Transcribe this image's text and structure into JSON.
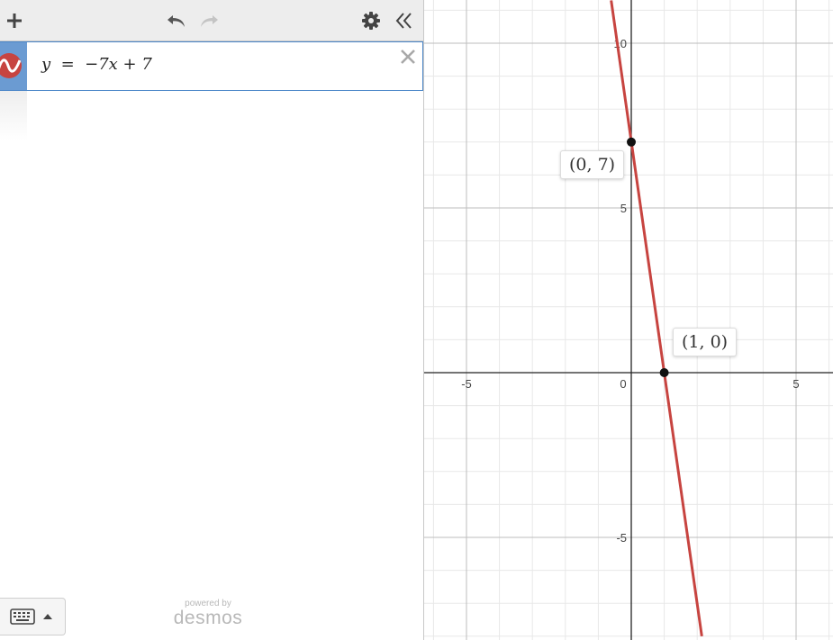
{
  "toolbar": {
    "add_icon": "plus-icon",
    "undo_icon": "undo-icon",
    "redo_icon": "redo-icon",
    "settings_icon": "gear-icon",
    "collapse_icon": "double-chevron-left-icon"
  },
  "expressions": [
    {
      "text": "y  =  −7x + 7",
      "color": "#c74440",
      "icon": "wave-icon"
    }
  ],
  "keypad": {
    "icon": "keyboard-icon",
    "arrow": "caret-up-icon"
  },
  "branding": {
    "powered_by": "powered by",
    "brand": "desmos"
  },
  "graph": {
    "x_ticks": [
      "-5",
      "0",
      "5"
    ],
    "y_ticks": [
      "10",
      "5",
      "-5"
    ],
    "points": [
      {
        "label": "(0, 7)",
        "x": 0,
        "y": 7
      },
      {
        "label": "(1, 0)",
        "x": 1,
        "y": 0
      }
    ],
    "line_color": "#c74440"
  },
  "chart_data": {
    "type": "line",
    "title": "",
    "xlabel": "",
    "ylabel": "",
    "xlim": [
      -6.2,
      6.2
    ],
    "ylim": [
      -8.0,
      11.3
    ],
    "x_ticks": [
      -5,
      0,
      5
    ],
    "y_ticks": [
      -5,
      5,
      10
    ],
    "grid": true,
    "series": [
      {
        "x": [
          -0.61,
          2.14
        ],
        "y": [
          11.3,
          -8.0
        ],
        "color": "#c74440"
      }
    ],
    "points": [
      {
        "x": 0,
        "y": 7,
        "label": "(0, 7)"
      },
      {
        "x": 1,
        "y": 0,
        "label": "(1, 0)"
      }
    ]
  }
}
